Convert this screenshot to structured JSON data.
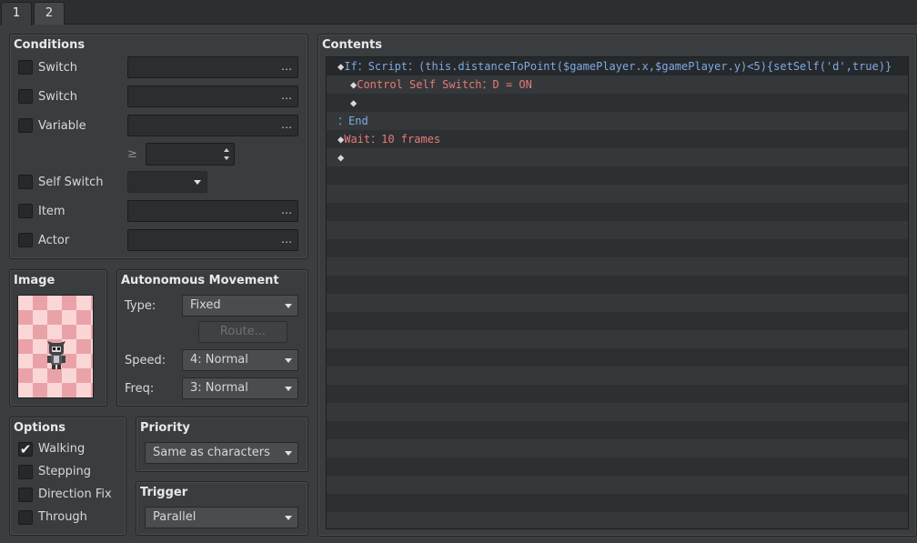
{
  "tabs": [
    "1",
    "2"
  ],
  "conditions": {
    "title": "Conditions",
    "rows": [
      {
        "label": "Switch",
        "checked": false
      },
      {
        "label": "Switch",
        "checked": false
      },
      {
        "label": "Variable",
        "checked": false
      },
      {
        "label": "Self Switch",
        "checked": false
      },
      {
        "label": "Item",
        "checked": false
      },
      {
        "label": "Actor",
        "checked": false
      }
    ],
    "ellipsis": "…",
    "gte_symbol": "≥",
    "variable_value": "",
    "self_switch_value": ""
  },
  "image": {
    "title": "Image"
  },
  "movement": {
    "title": "Autonomous Movement",
    "type_label": "Type:",
    "type_value": "Fixed",
    "route_label": "Route...",
    "speed_label": "Speed:",
    "speed_value": "4: Normal",
    "freq_label": "Freq:",
    "freq_value": "3: Normal"
  },
  "options": {
    "title": "Options",
    "items": [
      {
        "label": "Walking",
        "checked": true
      },
      {
        "label": "Stepping",
        "checked": false
      },
      {
        "label": "Direction Fix",
        "checked": false
      },
      {
        "label": "Through",
        "checked": false
      }
    ]
  },
  "priority": {
    "title": "Priority",
    "value": "Same as characters"
  },
  "trigger": {
    "title": "Trigger",
    "value": "Parallel"
  },
  "contents": {
    "title": "Contents",
    "commands": [
      {
        "marker": "◆",
        "parts": [
          {
            "t": "If：Script：(this.distanceToPoint($gamePlayer.x,$gamePlayer.y)<5){setSelf('d',true)}",
            "c": "blue"
          }
        ]
      },
      {
        "marker": "◆",
        "parts": [
          {
            "t": "Control Self Switch：D = ON",
            "c": "red"
          }
        ]
      },
      {
        "marker": "◆",
        "parts": []
      },
      {
        "marker": "",
        "parts": [
          {
            "t": "：End",
            "c": "blue"
          }
        ]
      },
      {
        "marker": "◆",
        "parts": [
          {
            "t": "Wait：10 frames",
            "c": "red"
          }
        ]
      },
      {
        "marker": "◆",
        "parts": []
      }
    ]
  },
  "colors": {
    "script_blue": "#7fa9e6",
    "command_red": "#e67a78",
    "checker_dark": "#e9a3a8",
    "checker_light": "#fbd6d6"
  }
}
